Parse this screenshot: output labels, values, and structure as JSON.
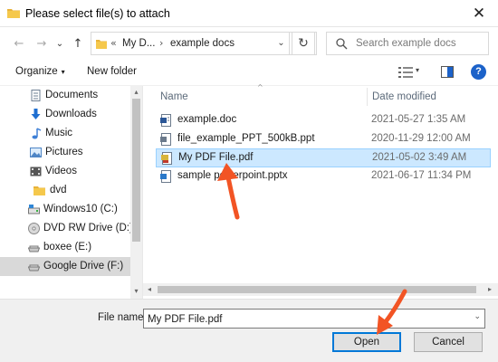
{
  "window": {
    "title": "Please select file(s) to attach",
    "close_glyph": "✕"
  },
  "nav": {
    "back_glyph": "←",
    "forward_glyph": "→",
    "recent_glyph": "⌄",
    "up_glyph": "↑",
    "address_sep": "«",
    "address_crumbs": [
      "My D...",
      "example docs"
    ],
    "address_crumb_sep": "›",
    "dropdown_glyph": "⌄",
    "refresh_glyph": "↻",
    "search_placeholder": "Search example docs"
  },
  "toolbar": {
    "organize_label": "Organize",
    "organize_caret": "▾",
    "new_folder_label": "New folder",
    "view_caret": "▾",
    "help_label": "?"
  },
  "sidebar": {
    "items": [
      {
        "label": "Documents",
        "icon": "documents-icon"
      },
      {
        "label": "Downloads",
        "icon": "downloads-icon"
      },
      {
        "label": "Music",
        "icon": "music-icon"
      },
      {
        "label": "Pictures",
        "icon": "pictures-icon"
      },
      {
        "label": "Videos",
        "icon": "videos-icon"
      },
      {
        "label": "dvd",
        "icon": "folder-icon"
      },
      {
        "label": "Windows10 (C:)",
        "icon": "drive-icon"
      },
      {
        "label": "DVD RW Drive (D:)",
        "icon": "dvd-drive-icon"
      },
      {
        "label": "boxee (E:)",
        "icon": "removable-drive-icon"
      },
      {
        "label": "Google Drive (F:)",
        "icon": "removable-drive-icon",
        "selected": true
      }
    ],
    "scroll_up_glyph": "▴",
    "scroll_down_glyph": "▾"
  },
  "filelist": {
    "columns": {
      "name": "Name",
      "date": "Date modified"
    },
    "sort_glyph": "^",
    "files": [
      {
        "name": "example.doc",
        "date": "2021-05-27 1:35 AM",
        "icon": "word-doc-icon"
      },
      {
        "name": "file_example_PPT_500kB.ppt",
        "date": "2020-11-29 12:00 AM",
        "icon": "ppt-icon"
      },
      {
        "name": "My PDF File.pdf",
        "date": "2021-05-02 3:49 AM",
        "icon": "pdf-icon",
        "selected": true
      },
      {
        "name": "sample powerpoint.pptx",
        "date": "2021-06-17 11:34 PM",
        "icon": "pptx-icon"
      }
    ],
    "scroll_left_glyph": "◂",
    "scroll_right_glyph": "▸"
  },
  "footer": {
    "filename_label": "File name:",
    "filename_value": "My PDF File.pdf",
    "filename_dd_glyph": "⌄",
    "open_label": "Open",
    "cancel_label": "Cancel"
  },
  "colors": {
    "accent": "#0078d7",
    "annotation_arrow": "#f25424",
    "selection_bg": "#cce8ff",
    "help_blue": "#1c62c9"
  }
}
